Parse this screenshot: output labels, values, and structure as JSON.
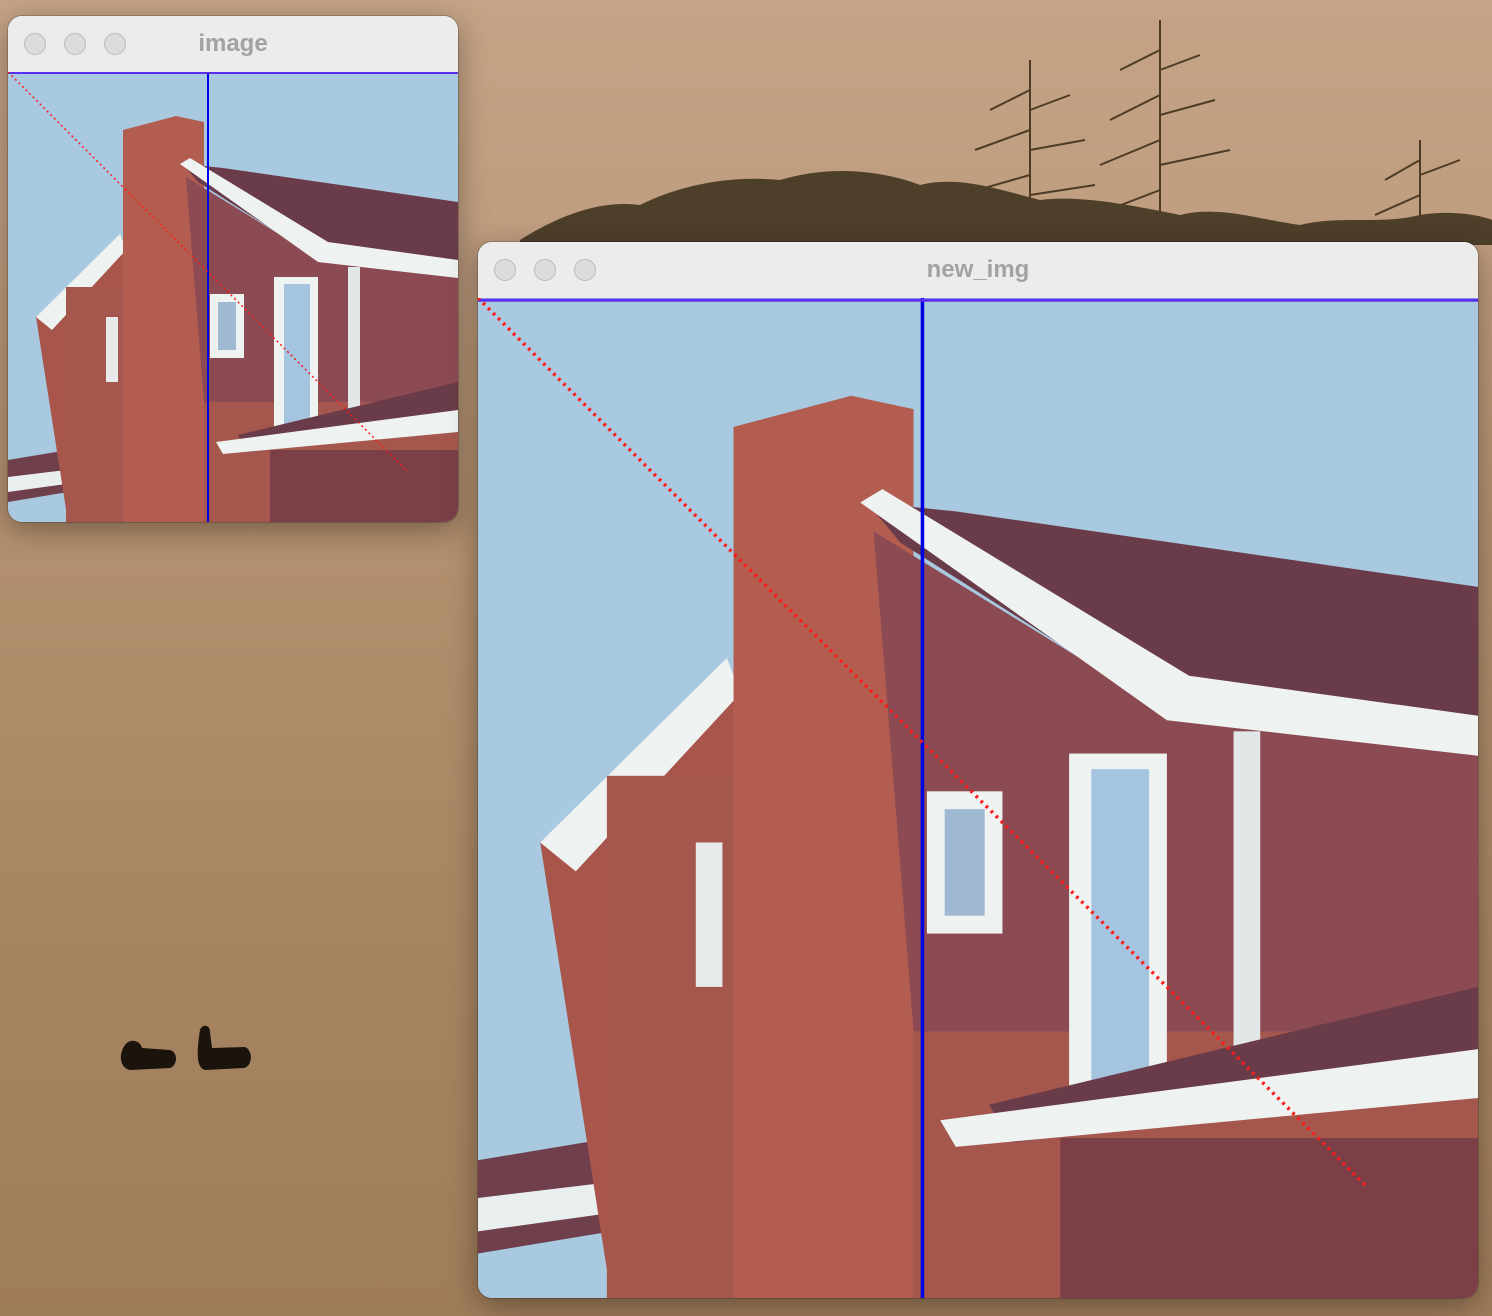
{
  "windows": [
    {
      "id": "image",
      "title": "image"
    },
    {
      "id": "new_img",
      "title": "new_img"
    }
  ],
  "overlay": {
    "vertical_line_color": "#0000e6",
    "diagonal_line_color": "#ff1a1a",
    "diagonal_style": "dotted"
  },
  "icons": {
    "close": "traffic-light-close-icon",
    "minimize": "traffic-light-minimize-icon",
    "zoom": "traffic-light-zoom-icon"
  }
}
